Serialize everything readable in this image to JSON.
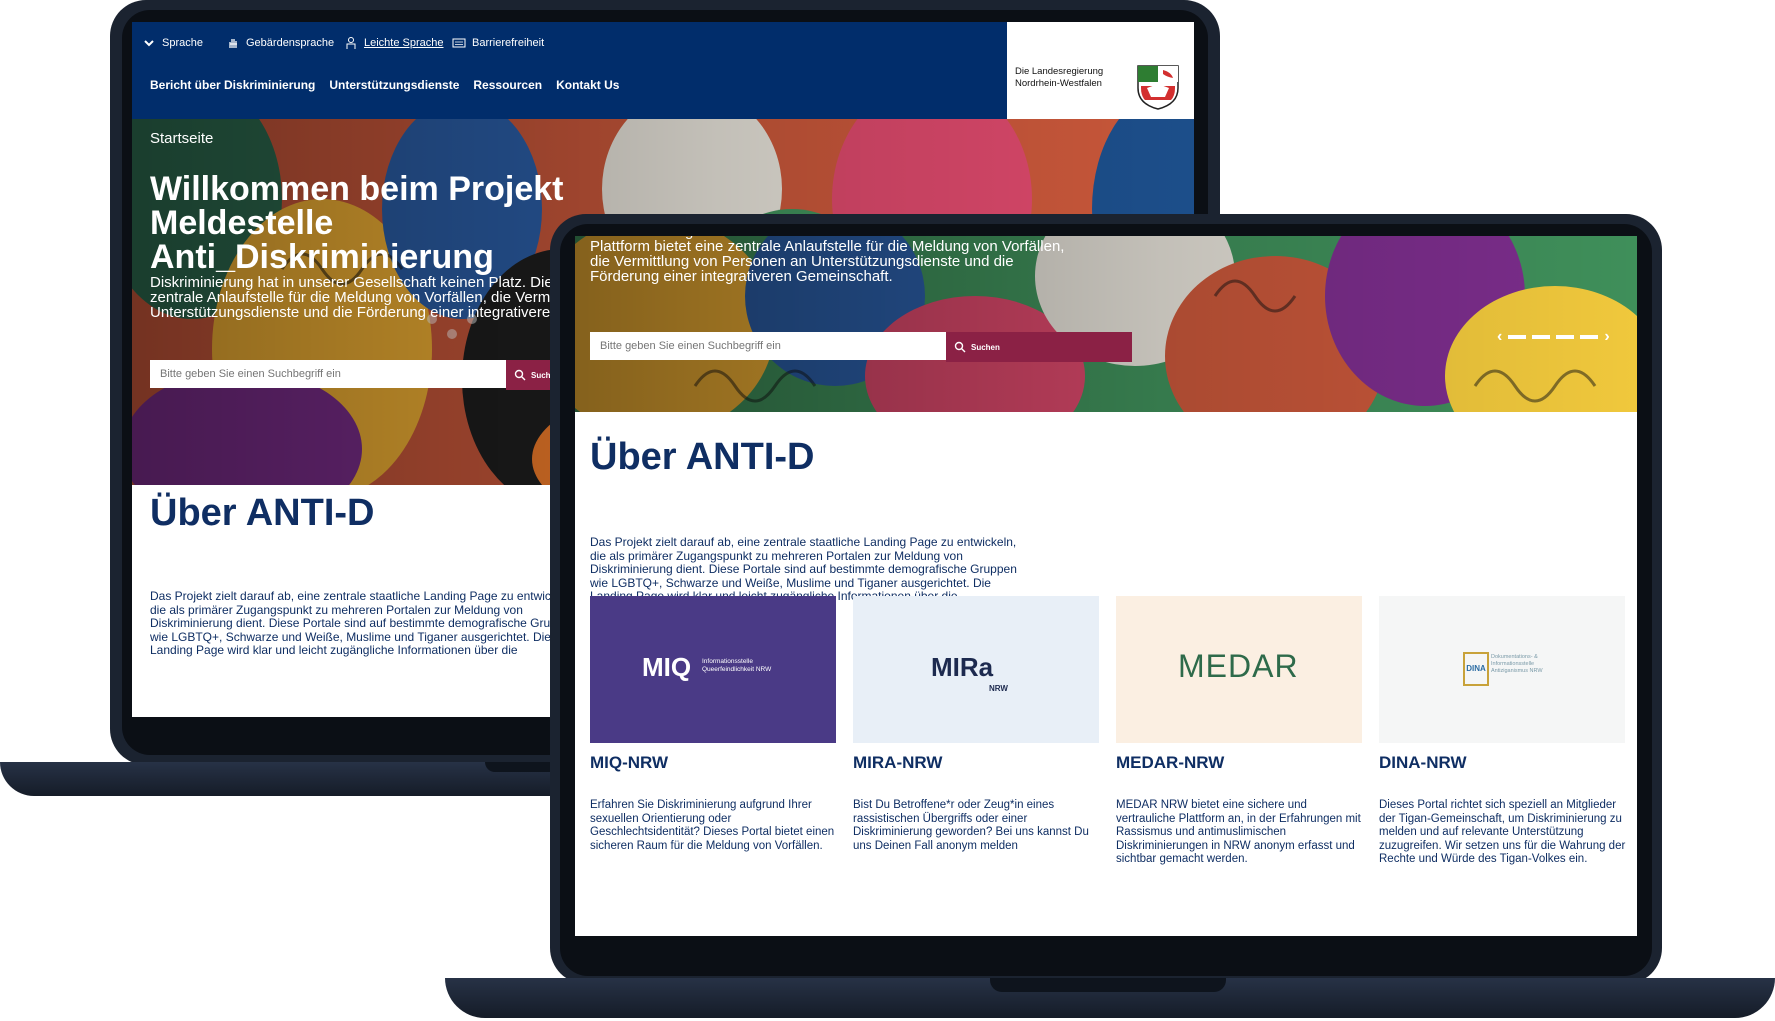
{
  "site": {
    "util_nav": [
      {
        "label": "Sprache",
        "icon": "chevron-down-icon"
      },
      {
        "label": "Gebärdensprache",
        "icon": "sign-language-icon"
      },
      {
        "label": "Leichte Sprache",
        "icon": "easy-language-icon"
      },
      {
        "label": "Barrierefreiheit",
        "icon": "keyboard-icon"
      }
    ],
    "main_nav": [
      "Bericht über Diskriminierung",
      "Unterstützungsdienste",
      "Ressourcen",
      "Kontakt Us"
    ],
    "logo": {
      "line1": "Die Landesregierung",
      "line2": "Nordrhein-Westfalen"
    },
    "breadcrumb": "Startseite",
    "hero": {
      "title": "Willkommen beim Projekt Meldestelle Anti_Diskriminierung",
      "lead": "Diskriminierung hat in unserer Gesellschaft keinen Platz. Diese Plattform bietet eine zentrale Anlaufstelle für die Meldung von Vorfällen, die Vermittlung von Personen an Unterstützungsdienste und die Förderung einer integrativeren Gemeinschaft.",
      "lead_partial": "Diskriminierung hat in unserer Gesellschaft keinen Platz. Diese",
      "search_placeholder": "Bitte geben Sie einen Suchbegriff ein",
      "search_button": "Suchen"
    },
    "about": {
      "title": "Über ANTI-D",
      "text": "Das Projekt zielt darauf ab, eine zentrale staatliche Landing Page zu entwickeln, die als primärer Zugangspunkt zu mehreren Portalen zur Meldung von Diskriminierung dient. Diese Portale sind auf bestimmte demografische Gruppen wie LGBTQ+, Schwarze und Weiße, Muslime und Tiganer ausgerichtet. Die Landing Page wird klar und leicht zugängliche Informationen über die"
    },
    "portals": [
      {
        "title": "MIQ-NRW",
        "logo_text": "MIQ",
        "logo_sub": "Informationsstelle Queerfeindlichkeit NRW",
        "bg": "#4a3a86",
        "text": "Erfahren Sie Diskriminierung aufgrund Ihrer sexuellen Orientierung oder Geschlechtsidentität? Dieses Portal bietet einen sicheren Raum für die Meldung von Vorfällen."
      },
      {
        "title": "MIRA-NRW",
        "logo_text": "MIRa",
        "logo_sub": "NRW",
        "bg": "#e8eff7",
        "text": "Bist Du Betroffene*r oder Zeug*in eines rassistischen Übergriffs oder einer Diskriminierung geworden? Bei uns kannst Du uns Deinen Fall anonym melden"
      },
      {
        "title": "MEDAR-NRW",
        "logo_text": "MEDAR",
        "logo_sub": "",
        "bg": "#fbefe2",
        "text": "MEDAR NRW bietet eine sichere und vertrauliche Plattform an, in der Erfahrungen mit Rassismus und antimuslimischen Diskriminierungen in NRW anonym erfasst und sichtbar gemacht werden."
      },
      {
        "title": "DINA-NRW",
        "logo_text": "DINA",
        "logo_sub": "Dokumentations- & Informationsstelle Antiziganismus NRW",
        "bg": "#f5f6f6",
        "text": "Dieses Portal richtet sich speziell an Mitglieder der Tigan-Gemeinschaft, um Diskriminierung zu melden und auf relevante Unterstützung zuzugreifen. Wir setzen uns für die Wahrung der Rechte und Würde des Tigan-Volkes ein."
      }
    ]
  },
  "colors": {
    "navy": "#012d6b",
    "accent": "#8b2145",
    "heading": "#0f2e63"
  }
}
